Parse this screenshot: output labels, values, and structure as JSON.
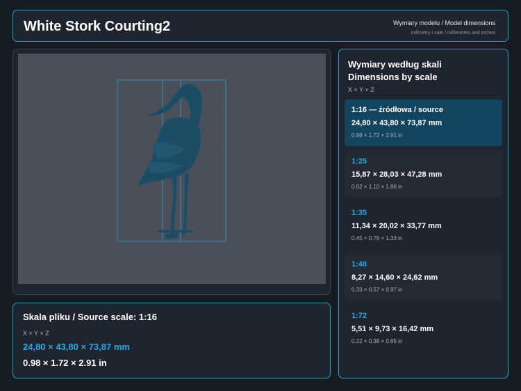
{
  "header": {
    "title": "White Stork Courting2",
    "subtitle": "Wymiary modelu / Model dimensions",
    "subtitle_small": "milimetry i cale / millimetres and inches"
  },
  "preview": {
    "model_icon": "bird-model-icon"
  },
  "source": {
    "heading": "Skala pliku / Source scale: 1:16",
    "axes": "X × Y × Z",
    "mm": "24,80 × 43,80 × 73,87 mm",
    "in": "0.98 × 1.72 × 2.91 in"
  },
  "scales": {
    "heading_pl": "Wymiary według skali",
    "heading_en": "Dimensions by scale",
    "axes": "X × Y × Z",
    "items": [
      {
        "ratio": "1:16  —  źródłowa / source",
        "mm": "24,80 × 43,80 × 73,87 mm",
        "in": "0.98 × 1.72 × 2.91 in"
      },
      {
        "ratio": "1:25",
        "mm": "15,87 × 28,03 × 47,28 mm",
        "in": "0.62 × 1.10 × 1.86 in"
      },
      {
        "ratio": "1:35",
        "mm": "11,34 × 20,02 × 33,77 mm",
        "in": "0.45 × 0.79 × 1.33 in"
      },
      {
        "ratio": "1:48",
        "mm": "8,27 × 14,60 × 24,62 mm",
        "in": "0.33 × 0.57 × 0.97 in"
      },
      {
        "ratio": "1:72",
        "mm": "5,51 × 9,73 × 16,42 mm",
        "in": "0.22 × 0.38 × 0.65 in"
      }
    ]
  },
  "colors": {
    "accent": "#2aa8e4",
    "background": "#171c23",
    "panel": "#1e252e",
    "active_card": "#14455f"
  }
}
